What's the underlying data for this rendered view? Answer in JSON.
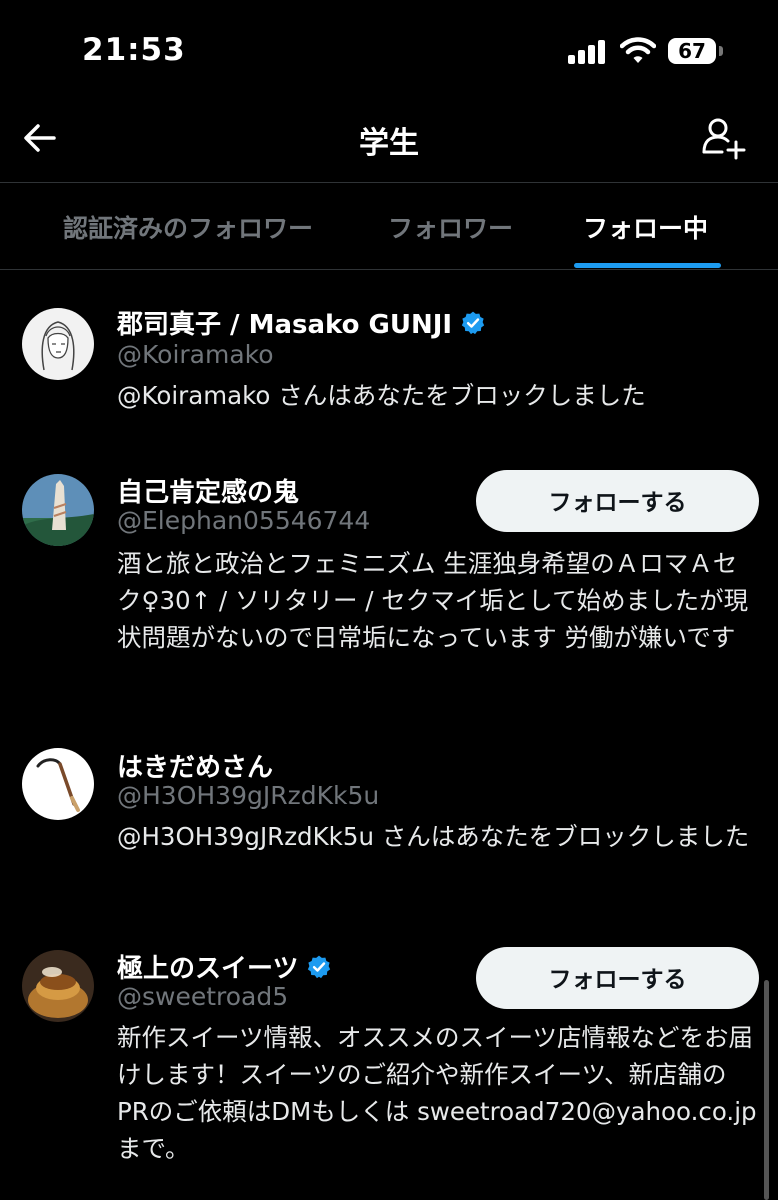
{
  "status": {
    "time": "21:53",
    "battery": "67"
  },
  "header": {
    "title": "学生"
  },
  "tabs": [
    {
      "label": "認証済みのフォロワー"
    },
    {
      "label": "フォロワー"
    },
    {
      "label": "フォロー中"
    }
  ],
  "follow_label": "フォローする",
  "users": [
    {
      "name": "郡司真子 / Masako GUNJI",
      "verified": true,
      "handle": "@Koiramako",
      "bio": "@Koiramako さんはあなたをブロックしました"
    },
    {
      "name": "自己肯定感の鬼",
      "verified": false,
      "handle": "@Elephan05546744",
      "bio": "酒と旅と政治とフェミニズム 生涯独身希望のＡロマＡセク♀30↑ / ソリタリー / セクマイ垢として始めましたが現状問題がないので日常垢になっています 労働が嫌いです"
    },
    {
      "name": "はきだめさん",
      "verified": false,
      "handle": "@H3OH39gJRzdKk5u",
      "bio": "@H3OH39gJRzdKk5u さんはあなたをブロックしました"
    },
    {
      "name": "極上のスイーツ",
      "verified": true,
      "handle": "@sweetroad5",
      "bio": "新作スイーツ情報、オススメのスイーツ店情報などをお届けします！スイーツのご紹介や新作スイーツ、新店舗のPRのご依頼はDMもしくは sweetroad720@yahoo.co.jp まで。"
    }
  ],
  "colors": {
    "background": "#000000",
    "accent": "#1d9bf0",
    "muted": "#71767b"
  }
}
